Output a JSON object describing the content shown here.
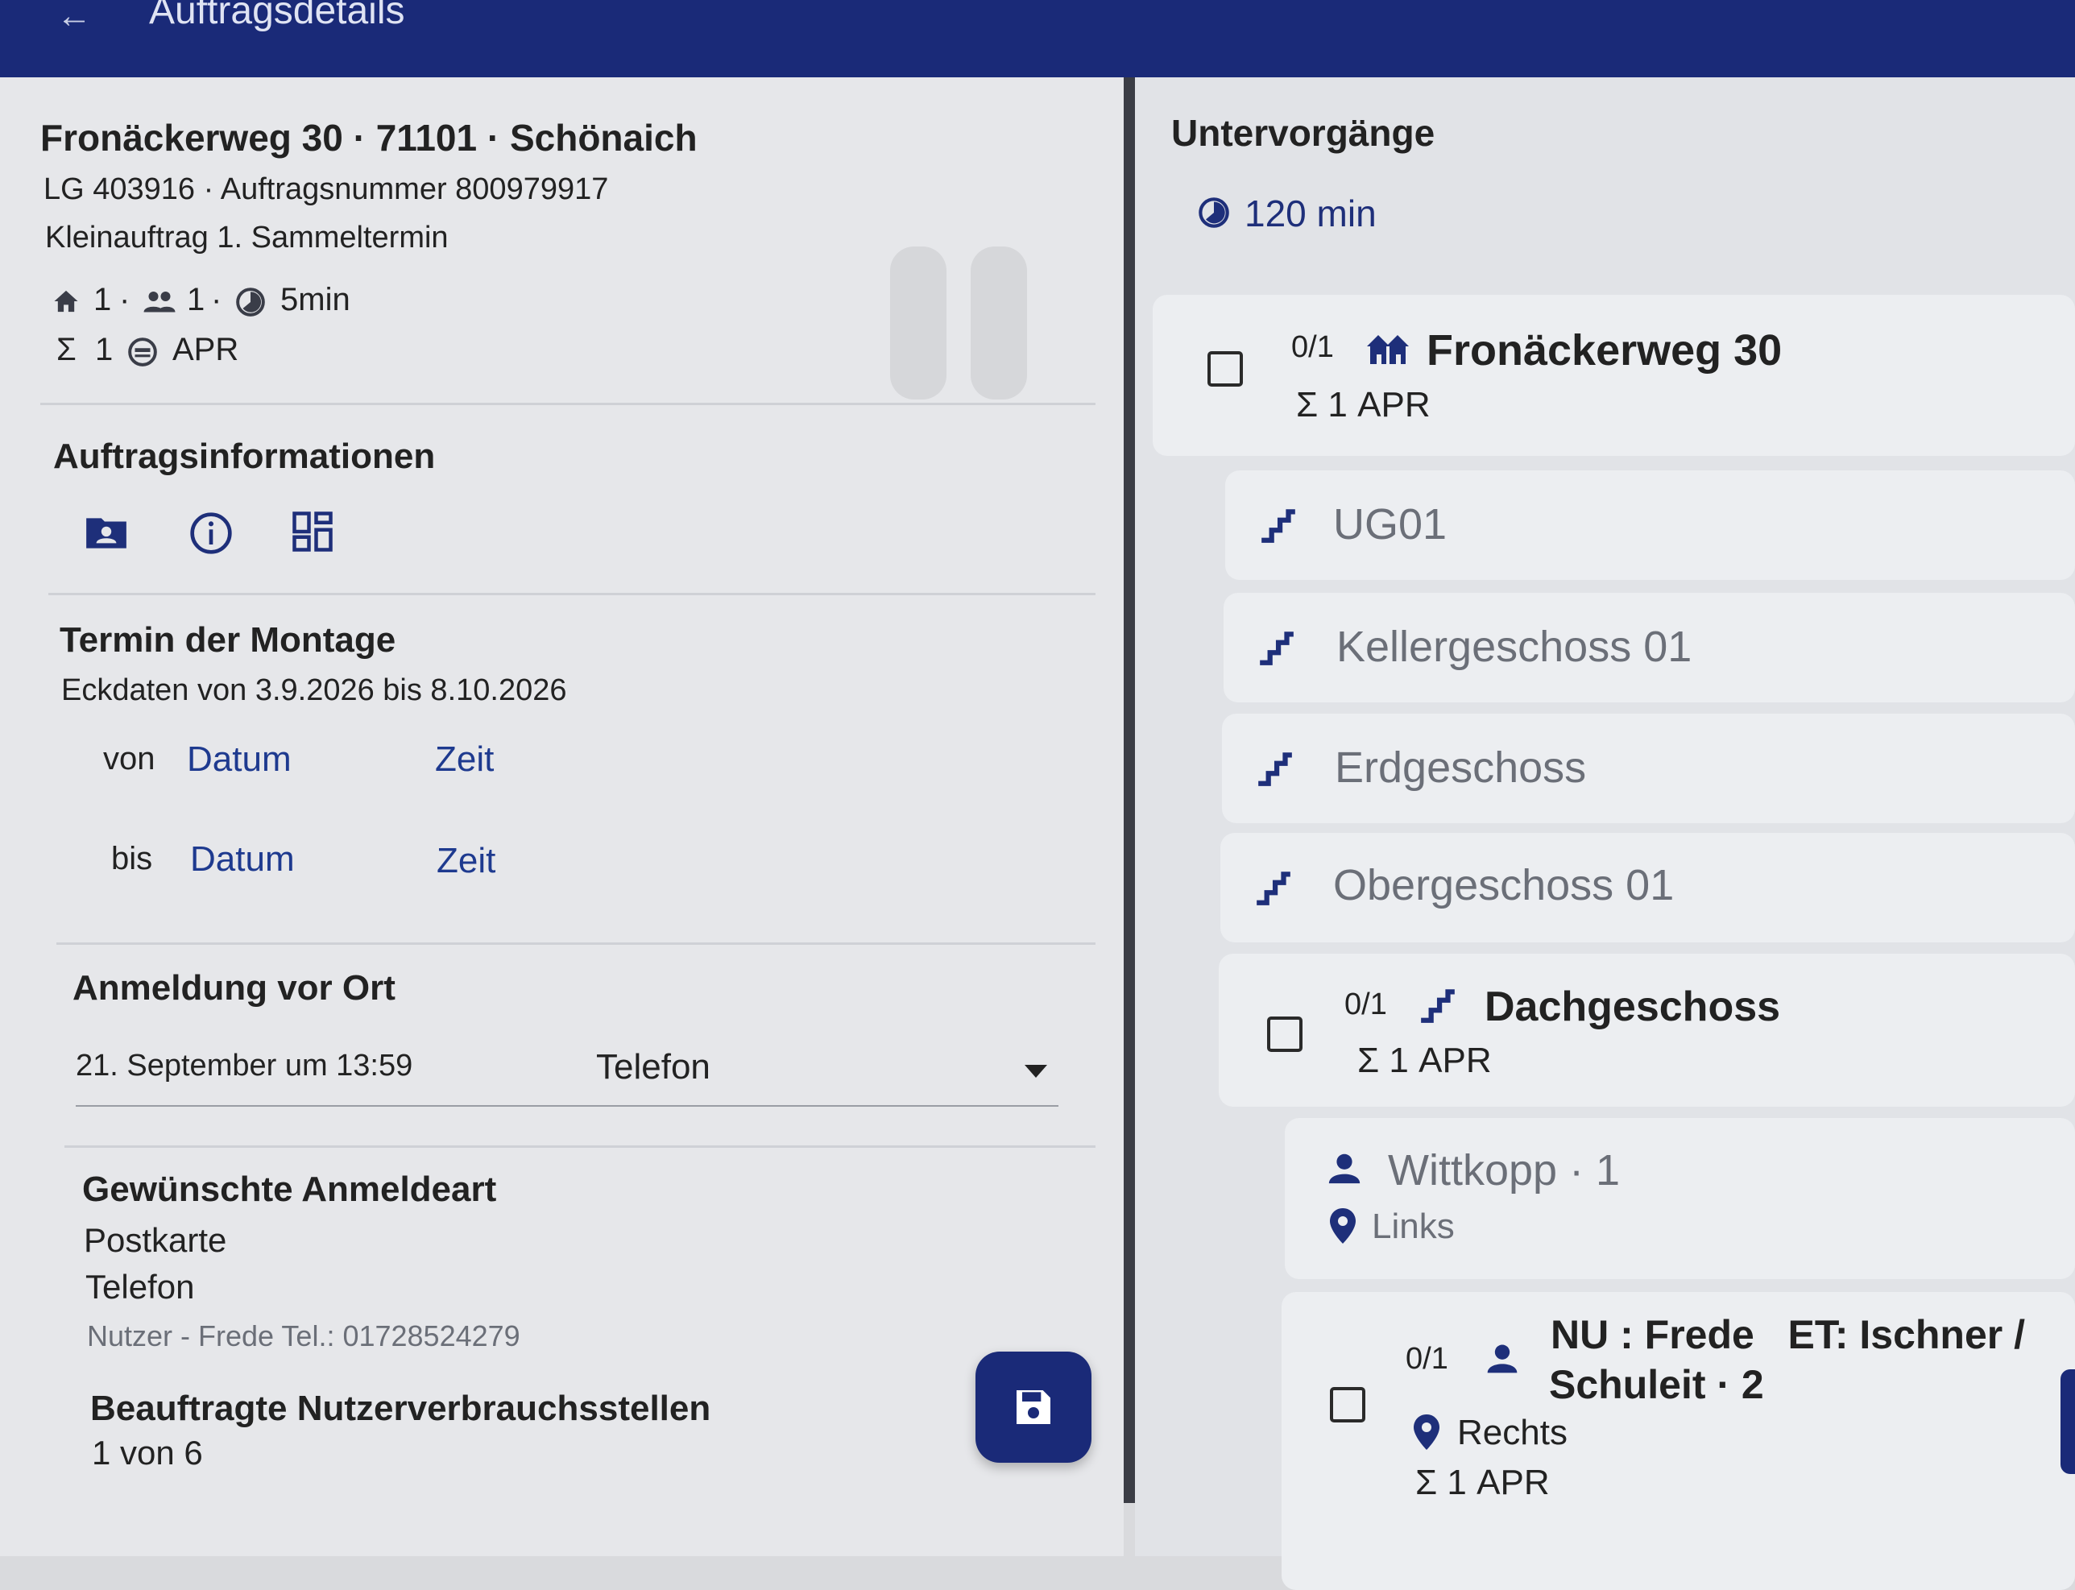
{
  "header": {
    "title": "Auftragsdetails"
  },
  "order": {
    "address": "Fronäckerweg 30 · 71101 · Schönaich",
    "ids": "LG 403916 · Auftragsnummer 800979917",
    "type": "Kleinauftrag 1. Sammeltermin",
    "stats": {
      "houses": "1",
      "persons": "1",
      "duration": "5min",
      "sum": "1",
      "unit": "APR"
    }
  },
  "auftragsinfo": {
    "heading": "Auftragsinformationen"
  },
  "termin": {
    "heading": "Termin der Montage",
    "eckdaten": "Eckdaten von 3.9.2026 bis 8.10.2026",
    "von_label": "von",
    "bis_label": "bis",
    "datum_label": "Datum",
    "zeit_label": "Zeit"
  },
  "anmeldung": {
    "heading": "Anmeldung vor Ort",
    "datetime": "21. September um 13:59",
    "method": "Telefon"
  },
  "gewuenscht": {
    "heading": "Gewünschte Anmeldeart",
    "options": [
      "Postkarte",
      "Telefon"
    ],
    "contact": "Nutzer -  Frede Tel.:  01728524279"
  },
  "beauftragte": {
    "heading": "Beauftragte Nutzerverbrauchsstellen",
    "value": "1 von 6"
  },
  "untervorgaenge": {
    "heading": "Untervorgänge",
    "duration": "120 min",
    "building": {
      "count": "0/1",
      "name": "Fronäckerweg 30",
      "sum": "Σ 1 APR"
    },
    "floors": [
      "UG01",
      "Kellergeschoss 01",
      "Erdgeschoss",
      "Obergeschoss 01"
    ],
    "dach": {
      "count": "0/1",
      "name": "Dachgeschoss",
      "sum": "Σ 1 APR"
    },
    "wittkopp": {
      "name": "Wittkopp · 1",
      "location": "Links"
    },
    "nu": {
      "count": "0/1",
      "line1": "NU : Frede   ET: Ischner /",
      "line2": "Schuleit · 2",
      "location": "Rechts",
      "sum": "Σ 1 APR"
    }
  }
}
